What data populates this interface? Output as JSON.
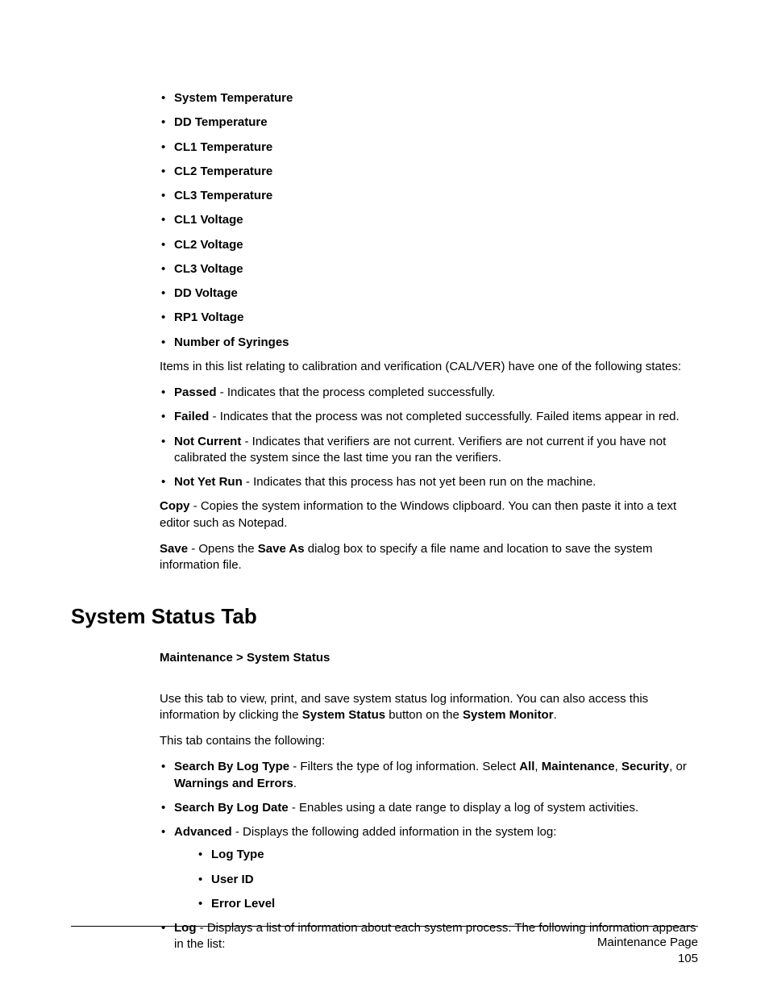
{
  "measure_list": [
    "System Temperature",
    "DD Temperature",
    "CL1 Temperature",
    "CL2 Temperature",
    "CL3 Temperature",
    "CL1 Voltage",
    "CL2 Voltage",
    "CL3 Voltage",
    "DD Voltage",
    "RP1 Voltage",
    "Number of Syringes"
  ],
  "calver_intro": "Items in this list relating to calibration and verification (CAL/VER) have one of the following states:",
  "states": [
    {
      "label": "Passed",
      "desc": " - Indicates that the process completed successfully."
    },
    {
      "label": "Failed",
      "desc": " - Indicates that the process was not completed successfully. Failed items appear in red."
    },
    {
      "label": "Not Current",
      "desc": " - Indicates that verifiers are not current. Verifiers are not current if you have not calibrated the system since the last time you ran the verifiers."
    },
    {
      "label": "Not Yet Run",
      "desc": " - Indicates that this process has not yet been run on the machine."
    }
  ],
  "copy_label": "Copy",
  "copy_desc": " - Copies the system information to the Windows clipboard. You can then paste it into a text editor such as Notepad.",
  "save_label": "Save",
  "save_desc_1": " - Opens the ",
  "save_as": "Save As",
  "save_desc_2": " dialog box to specify a file name and location to save the system information file.",
  "section_title": "System Status Tab",
  "breadcrumb_1": "Maintenance",
  "breadcrumb_sep": " > ",
  "breadcrumb_2": "System Status",
  "status_intro_1": "Use this tab to view, print, and save system status log information. You can also access this information by clicking the ",
  "status_intro_b1": "System Status",
  "status_intro_2": " button on the ",
  "status_intro_b2": "System Monitor",
  "status_intro_3": ".",
  "tab_contains": "This tab contains the following:",
  "search_type_label": "Search By Log Type",
  "search_type_1": " - Filters the type of log information. Select ",
  "search_type_all": "All",
  "search_type_2": ", ",
  "search_type_maint": "Maintenance",
  "search_type_3": ", ",
  "search_type_sec": "Security",
  "search_type_4": ", or ",
  "search_type_warn": "Warnings and Errors",
  "search_type_5": ".",
  "search_date_label": "Search By Log Date",
  "search_date_desc": " - Enables using a date range to display a log of system activities.",
  "advanced_label": "Advanced",
  "advanced_desc": " - Displays the following added information in the system log:",
  "advanced_items": [
    "Log Type",
    "User ID",
    "Error Level"
  ],
  "log_label": "Log",
  "log_desc": " - Displays a list of information about each system process. The following information appears in the list:",
  "footer_title": "Maintenance Page",
  "footer_num": "105"
}
